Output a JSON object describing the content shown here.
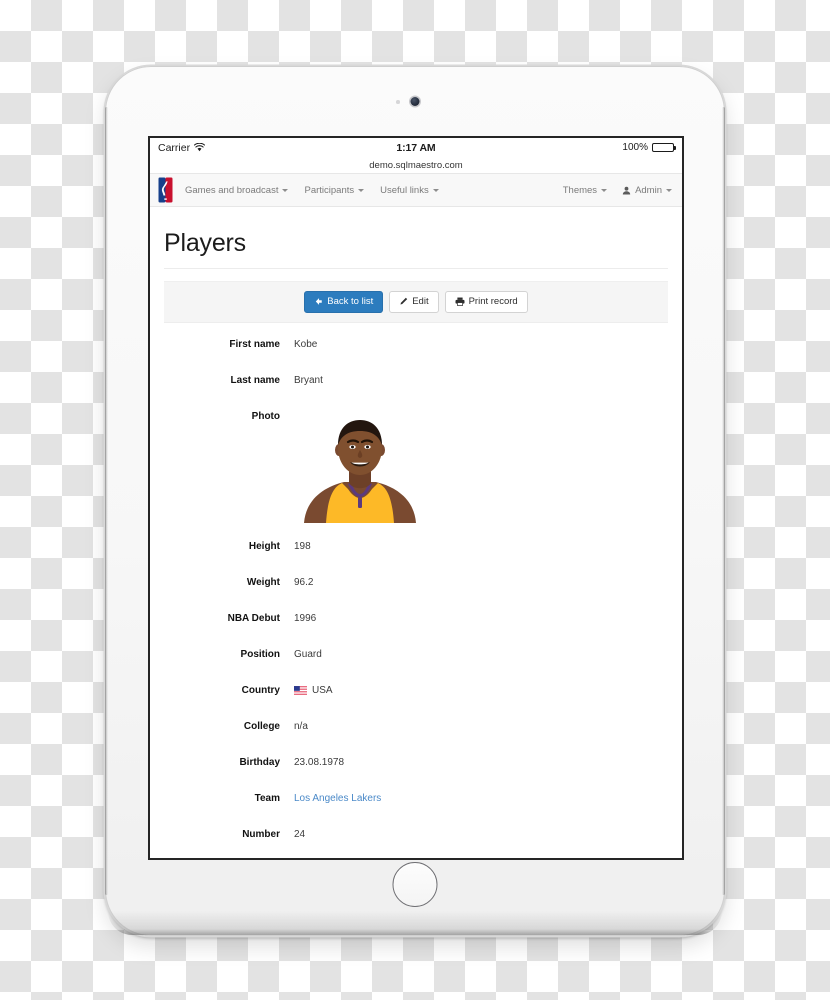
{
  "status_bar": {
    "carrier": "Carrier",
    "wifi_icon": "wifi-icon",
    "time": "1:17 AM",
    "battery_percent": "100%",
    "battery_icon": "battery-icon"
  },
  "browser": {
    "url": "demo.sqlmaestro.com"
  },
  "navbar": {
    "brand_icon": "nba-logo-icon",
    "left_items": [
      {
        "label": "Games and broadcast",
        "caret": true
      },
      {
        "label": "Participants",
        "caret": true
      },
      {
        "label": "Useful links",
        "caret": true
      }
    ],
    "right_items": [
      {
        "label": "Themes",
        "caret": true,
        "icon": ""
      },
      {
        "label": "Admin",
        "caret": true,
        "icon": "user-icon"
      }
    ]
  },
  "page": {
    "title": "Players"
  },
  "toolbar": {
    "back_label": "Back to list",
    "back_icon": "arrow-left-icon",
    "edit_label": "Edit",
    "edit_icon": "pencil-icon",
    "print_label": "Print record",
    "print_icon": "printer-icon"
  },
  "record": {
    "fields": [
      {
        "label": "First name",
        "value": "Kobe",
        "type": "text"
      },
      {
        "label": "Last name",
        "value": "Bryant",
        "type": "text"
      },
      {
        "label": "Photo",
        "value": "",
        "type": "photo",
        "photo_alt": "player-headshot"
      },
      {
        "label": "Height",
        "value": "198",
        "type": "text"
      },
      {
        "label": "Weight",
        "value": "96.2",
        "type": "text"
      },
      {
        "label": "NBA Debut",
        "value": "1996",
        "type": "text"
      },
      {
        "label": "Position",
        "value": "Guard",
        "type": "text"
      },
      {
        "label": "Country",
        "value": "USA",
        "type": "flag",
        "flag_icon": "us-flag-icon"
      },
      {
        "label": "College",
        "value": "n/a",
        "type": "text"
      },
      {
        "label": "Birthday",
        "value": "23.08.1978",
        "type": "text"
      },
      {
        "label": "Team",
        "value": "Los Angeles Lakers",
        "type": "link"
      },
      {
        "label": "Number",
        "value": "24",
        "type": "text"
      }
    ]
  },
  "colors": {
    "primary_button": "#2c7cbe",
    "link": "#4a89c8",
    "nba_blue": "#17408b",
    "nba_red": "#c8102e",
    "jersey_gold": "#fdb927",
    "toolbar_bg": "#f5f5f5"
  }
}
